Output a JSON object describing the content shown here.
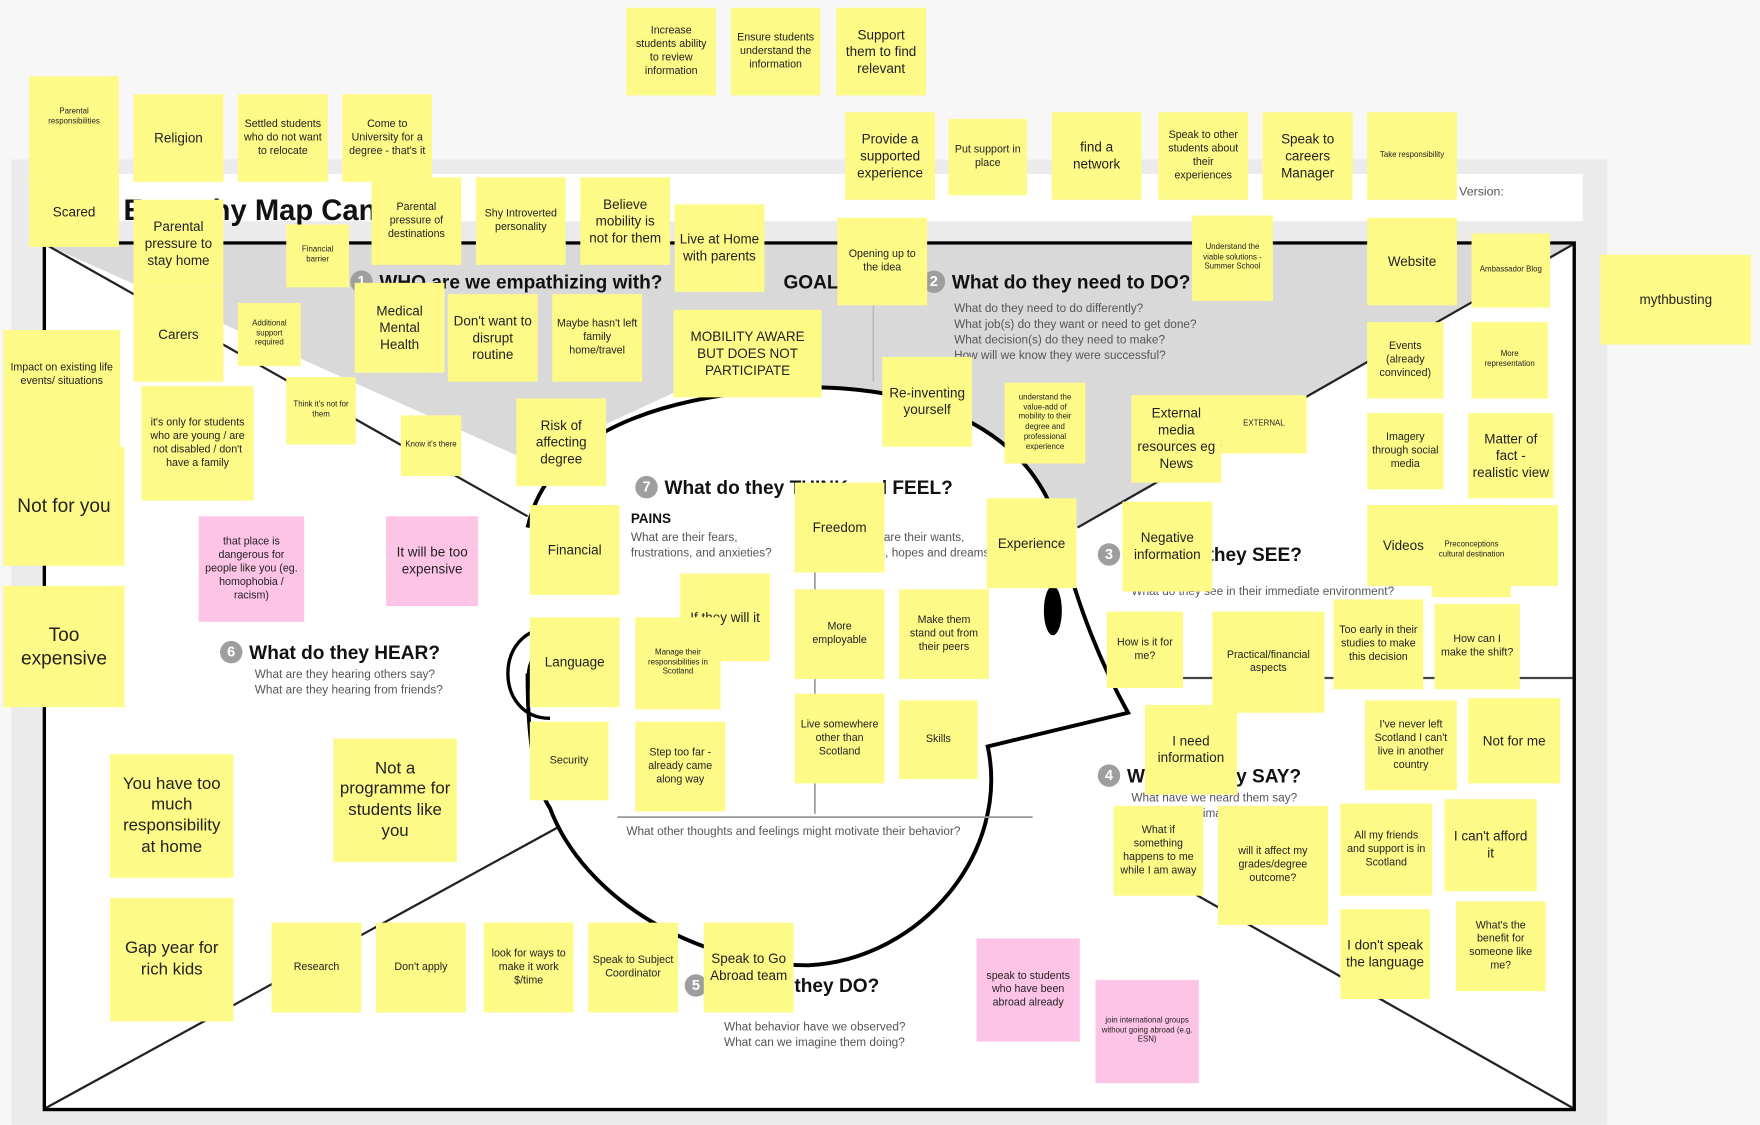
{
  "canvas": {
    "title": "Empathy Map Canvas",
    "version_label": "Version:",
    "goal_label": "GOAL",
    "sections": [
      {
        "number": "1",
        "title": "WHO are we empathizing with?"
      },
      {
        "number": "2",
        "title": "What do they need to DO?",
        "questions": "What do they need to do differently?\nWhat job(s) do they want or need to get done?\nWhat decision(s) do they need to make?\nHow will we know they were successful?"
      },
      {
        "number": "3",
        "title": "What do they SEE?",
        "questions": "What do they see in their immediate environment?"
      },
      {
        "number": "4",
        "title": "What do they SAY?",
        "questions": "What have we heard them say?\nWhat can we imagine them saying?"
      },
      {
        "number": "5",
        "title": "What do they DO?",
        "questions": "What behavior have we observed?\nWhat can we imagine them doing?"
      },
      {
        "number": "6",
        "title": "What do they HEAR?",
        "questions": "What are they hearing others say?\nWhat are they hearing from friends?"
      },
      {
        "number": "7",
        "title": "What do they THINK and FEEL?",
        "pains_title": "PAINS",
        "pains_q": "What are their fears,\nfrustrations, and anxieties?",
        "gains_q": "What are their wants,\nneeds, hopes and dreams?",
        "footer_q": "What other thoughts and feelings might motivate their behavior?"
      }
    ]
  },
  "colors": {
    "yellow_note": "#fdfa87",
    "pink_note": "#fec4e6"
  },
  "notes": [
    {
      "text": "Increase students ability to review information",
      "color": "yellow"
    },
    {
      "text": "Ensure students understand the information",
      "color": "yellow"
    },
    {
      "text": "Support them to find relevant",
      "color": "yellow"
    },
    {
      "text": "Parental responsibilities",
      "color": "yellow"
    },
    {
      "text": "Religion",
      "color": "yellow"
    },
    {
      "text": "Settled students who do not want to relocate",
      "color": "yellow"
    },
    {
      "text": "Come to University for a degree - that's it",
      "color": "yellow"
    },
    {
      "text": "Provide a supported experience",
      "color": "yellow"
    },
    {
      "text": "Put support in place",
      "color": "yellow"
    },
    {
      "text": "find a network",
      "color": "yellow"
    },
    {
      "text": "Speak to other students about their experiences",
      "color": "yellow"
    },
    {
      "text": "Speak to careers Manager",
      "color": "yellow"
    },
    {
      "text": "Take responsibility",
      "color": "yellow"
    },
    {
      "text": "Scared",
      "color": "yellow"
    },
    {
      "text": "Parental pressure to stay home",
      "color": "yellow"
    },
    {
      "text": "Financial barrier",
      "color": "yellow"
    },
    {
      "text": "Parental pressure of destinations",
      "color": "yellow"
    },
    {
      "text": "Shy Introverted personality",
      "color": "yellow"
    },
    {
      "text": "Believe mobility is not for them",
      "color": "yellow"
    },
    {
      "text": "Live at Home with parents",
      "color": "yellow"
    },
    {
      "text": "Opening up to the idea",
      "color": "yellow"
    },
    {
      "text": "Understand the viable solutions - Summer School",
      "color": "yellow"
    },
    {
      "text": "Website",
      "color": "yellow"
    },
    {
      "text": "Ambassador Blog",
      "color": "yellow"
    },
    {
      "text": "mythbusting",
      "color": "yellow"
    },
    {
      "text": "Carers",
      "color": "yellow"
    },
    {
      "text": "Additional support required",
      "color": "yellow"
    },
    {
      "text": "Medical Mental Health",
      "color": "yellow"
    },
    {
      "text": "Don't want to disrupt routine",
      "color": "yellow"
    },
    {
      "text": "Maybe hasn't left family home/travel",
      "color": "yellow"
    },
    {
      "text": "MOBILITY AWARE BUT DOES NOT PARTICIPATE",
      "color": "yellow"
    },
    {
      "text": "Impact on existing life events/ situations",
      "color": "yellow"
    },
    {
      "text": "it's only for students who are young / are not disabled / don't have a family",
      "color": "yellow"
    },
    {
      "text": "Think it's not for them",
      "color": "yellow"
    },
    {
      "text": "Know it's there",
      "color": "yellow"
    },
    {
      "text": "Risk of affecting degree",
      "color": "yellow"
    },
    {
      "text": "Re-inventing yourself",
      "color": "yellow"
    },
    {
      "text": "understand the value-add of mobility to their degree and professional experience",
      "color": "yellow"
    },
    {
      "text": "External media resources eg News",
      "color": "yellow"
    },
    {
      "text": "EXTERNAL",
      "color": "yellow"
    },
    {
      "text": "Events (already convinced)",
      "color": "yellow"
    },
    {
      "text": "More representation",
      "color": "yellow"
    },
    {
      "text": "Imagery through social media",
      "color": "yellow"
    },
    {
      "text": "Matter of fact - realistic view",
      "color": "yellow"
    },
    {
      "text": "Not for you",
      "color": "yellow"
    },
    {
      "text": "that place is dangerous for people like you (eg. homophobia / racism)",
      "color": "pink"
    },
    {
      "text": "It will be too expensive",
      "color": "pink"
    },
    {
      "text": "Financial",
      "color": "yellow"
    },
    {
      "text": "Freedom",
      "color": "yellow"
    },
    {
      "text": "Experience",
      "color": "yellow"
    },
    {
      "text": "Negative information",
      "color": "yellow"
    },
    {
      "text": "Videos",
      "color": "yellow"
    },
    {
      "text": "Preconceptions cultural destination",
      "color": "yellow"
    },
    {
      "text": "If they will it",
      "color": "yellow"
    },
    {
      "text": "Too expensive",
      "color": "yellow"
    },
    {
      "text": "Language",
      "color": "yellow"
    },
    {
      "text": "Manage their responsibilities in Scotland",
      "color": "yellow"
    },
    {
      "text": "More employable",
      "color": "yellow"
    },
    {
      "text": "Make them stand out from their peers",
      "color": "yellow"
    },
    {
      "text": "How is it for me?",
      "color": "yellow"
    },
    {
      "text": "Practical/financial aspects",
      "color": "yellow"
    },
    {
      "text": "Too early in their studies to make this decision",
      "color": "yellow"
    },
    {
      "text": "How can I make the shift?",
      "color": "yellow"
    },
    {
      "text": "I've never left Scotland I can't live in another country",
      "color": "yellow"
    },
    {
      "text": "Not for me",
      "color": "yellow"
    },
    {
      "text": "I need information",
      "color": "yellow"
    },
    {
      "text": "Security",
      "color": "yellow"
    },
    {
      "text": "Step too far - already came along way",
      "color": "yellow"
    },
    {
      "text": "Live somewhere other than Scotland",
      "color": "yellow"
    },
    {
      "text": "Skills",
      "color": "yellow"
    },
    {
      "text": "Not a programme for students like you",
      "color": "yellow"
    },
    {
      "text": "You have too much responsibility at home",
      "color": "yellow"
    },
    {
      "text": "What if something happens to me while I am away",
      "color": "yellow"
    },
    {
      "text": "will it affect my grades/degree outcome?",
      "color": "yellow"
    },
    {
      "text": "All my friends and support is in Scotland",
      "color": "yellow"
    },
    {
      "text": "I can't afford it",
      "color": "yellow"
    },
    {
      "text": "Gap year for rich kids",
      "color": "yellow"
    },
    {
      "text": "Research",
      "color": "yellow"
    },
    {
      "text": "Don't apply",
      "color": "yellow"
    },
    {
      "text": "look for ways to make it work $/time",
      "color": "yellow"
    },
    {
      "text": "Speak to Subject Coordinator",
      "color": "yellow"
    },
    {
      "text": "Speak to Go Abroad team",
      "color": "yellow"
    },
    {
      "text": "speak to students who have been abroad already",
      "color": "pink"
    },
    {
      "text": "join international groups without going abroad (e.g. ESN)",
      "color": "pink"
    },
    {
      "text": "I don't speak the language",
      "color": "yellow"
    },
    {
      "text": "What's the benefit for someone like me?",
      "color": "yellow"
    }
  ]
}
